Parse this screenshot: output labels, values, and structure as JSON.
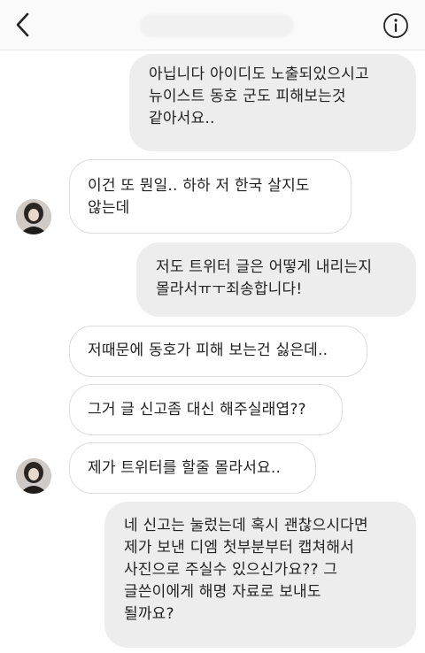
{
  "header": {
    "back_icon": "chevron-left-icon",
    "info_icon": "info-circle-icon"
  },
  "messages": [
    {
      "direction": "sent",
      "text": "아닙니다 아이디도 노출되있으시고\n뉴이스트 동호 군도 피해보는것\n같아서요.."
    },
    {
      "direction": "received",
      "text": "이건 또 뭔일.. 하하 저 한국 살지도\n않는데"
    },
    {
      "direction": "sent",
      "text": "저도 트위터 글은 어떻게 내리는지\n몰라서ㅠㅜ죄송합니다!"
    },
    {
      "direction": "received",
      "text": "저때문에 동호가 피해 보는건 싫은데.."
    },
    {
      "direction": "received",
      "text": "그거 글 신고좀 대신 해주실래엽??"
    },
    {
      "direction": "received",
      "text": "제가 트위터를 할줄 몰라서요.."
    },
    {
      "direction": "sent",
      "text": "네 신고는 눌렀는데 혹시 괜찮으시다면\n제가 보낸 디엠 첫부분부터 캡쳐해서\n사진으로 주실수 있으신가요?? 그\n글쓴이에게 해명 자료로 보내도\n될까요?"
    }
  ]
}
